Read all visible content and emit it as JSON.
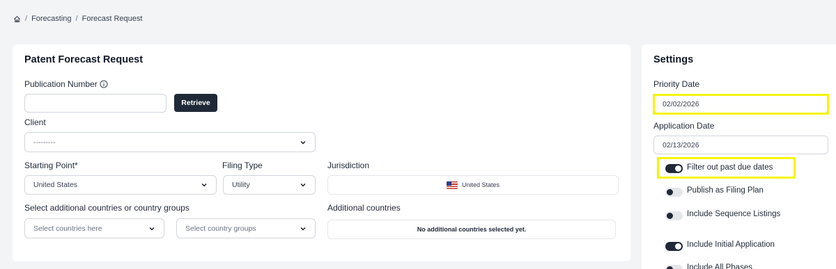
{
  "breadcrumb": {
    "items": [
      "Forecasting",
      "Forecast Request"
    ],
    "separator": "/"
  },
  "main": {
    "title": "Patent Forecast Request",
    "publication_number": {
      "label": "Publication Number",
      "value": "",
      "button": "Retrieve"
    },
    "client": {
      "label": "Client",
      "value": "---------"
    },
    "starting_point": {
      "label": "Starting Point*",
      "value": "United States"
    },
    "filing_type": {
      "label": "Filing Type",
      "value": "Utility"
    },
    "jurisdiction": {
      "label": "Jurisdiction",
      "value": "United States"
    },
    "additional_select": {
      "label": "Select additional countries or country groups",
      "countries_placeholder": "Select countries here",
      "groups_placeholder": "Select country groups"
    },
    "additional_countries": {
      "label": "Additional countries",
      "empty_text": "No additional countries selected yet."
    }
  },
  "settings": {
    "title": "Settings",
    "priority_date": {
      "label": "Priority Date",
      "value": "02/02/2026"
    },
    "application_date": {
      "label": "Application Date",
      "value": "02/13/2026"
    },
    "toggles": [
      {
        "label": "Filter out past due dates",
        "on": true
      },
      {
        "label": "Publish as Filing Plan",
        "on": false
      },
      {
        "label": "Include Sequence Listings",
        "on": false
      },
      {
        "label": "Include Initial Application",
        "on": true
      },
      {
        "label": "Include All Phases",
        "on": false
      }
    ]
  },
  "colors": {
    "highlight": "#f5f500",
    "dark": "#1f2937",
    "background": "#f3f4f6"
  }
}
